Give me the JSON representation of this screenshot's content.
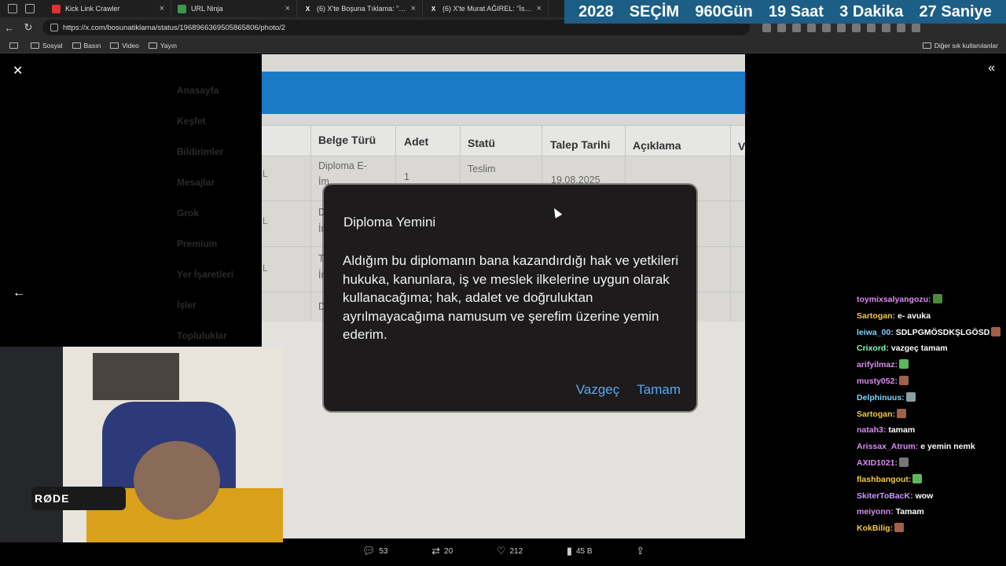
{
  "browser": {
    "tabs": [
      {
        "title": "Kick Link Crawler",
        "favicon": "kick-favicon"
      },
      {
        "title": "URL Ninja",
        "favicon": "ninja-favicon"
      },
      {
        "title": "(6) X'te Boşuna Tıklama: \"İstanbul",
        "favicon": "x-favicon"
      },
      {
        "title": "(6) X'te Murat AĞIREL: \"İstanbul C",
        "favicon": "x-favicon"
      }
    ],
    "url": "https://x.com/bosunatiklama/status/1968966369505865806/photo/2",
    "bookmarks": [
      "Sosyal",
      "Basın",
      "Video",
      "Yayın"
    ],
    "bookmarks_other": "Diğer sık kullanılanlar"
  },
  "countdown": {
    "year": "2028",
    "label": "SEÇİM",
    "days": "960Gün",
    "hours": "19 Saat",
    "minutes": "3  Dakika",
    "seconds": "27 Saniye"
  },
  "photo_table": {
    "headers": [
      "Belge Türü",
      "Adet",
      "Statü",
      "Talep Tarihi",
      "Açıklama",
      "V"
    ],
    "row1": {
      "type": "Diploma E-",
      "type2": "İm",
      "count": "1",
      "status": "Teslim",
      "date": "19.08.2025"
    },
    "row2": {
      "type": "D",
      "type2": "İn"
    },
    "row3": {
      "type": "Tr",
      "type2": "İn"
    },
    "row4": {
      "type": "D"
    },
    "left_marks": [
      "L",
      "L",
      "L"
    ]
  },
  "x_sidebar": [
    "Anasayfa",
    "Keşfet",
    "Bildirimler",
    "Mesajlar",
    "Grok",
    "Premium",
    "Yer İşaretleri",
    "İşler",
    "Topluluklar"
  ],
  "dialog": {
    "title": "Diploma Yemini",
    "body": "Aldığım bu diplomanın bana kazandırdığı hak ve yetkileri hukuka, kanunlara, iş ve meslek ilkelerine uygun olarak kullanacağıma; hak, adalet ve doğruluktan ayrılmayacağıma namusum ve şerefim üzerine yemin ederim.",
    "cancel": "Vazgeç",
    "ok": "Tamam"
  },
  "chat": [
    {
      "user": "toymixsalyangozu:",
      "msg": "",
      "color": "#d98cf0",
      "emote": "#4a8a3a"
    },
    {
      "user": "Sartogan:",
      "msg": "e- avuka",
      "color": "#f5c842",
      "emote": ""
    },
    {
      "user": "leiwa_00:",
      "msg": "SDLPGMÖSDKŞLGÖSD",
      "color": "#7fd3ff",
      "emote": "#a0604a"
    },
    {
      "user": "Crixord:",
      "msg": "vazgeç tamam",
      "color": "#7fffb0",
      "emote": ""
    },
    {
      "user": "arifyilmaz:",
      "msg": "",
      "color": "#d98cf0",
      "emote": "#5cb85c"
    },
    {
      "user": "musty052:",
      "msg": "",
      "color": "#d98cf0",
      "emote": "#a0604a"
    },
    {
      "user": "Delphinuus:",
      "msg": "",
      "color": "#7fd3ff",
      "emote": "#8aa0a0"
    },
    {
      "user": "Sartogan:",
      "msg": "",
      "color": "#f5c842",
      "emote": "#a0604a"
    },
    {
      "user": "natah3:",
      "msg": "tamam",
      "color": "#d98cf0",
      "emote": ""
    },
    {
      "user": "Arissax_Atrum:",
      "msg": "e yemin nemk",
      "color": "#d98cf0",
      "emote": ""
    },
    {
      "user": "AXID1021:",
      "msg": "",
      "color": "#d98cf0",
      "emote": "#777777"
    },
    {
      "user": "flashbangout:",
      "msg": "",
      "color": "#f5c842",
      "emote": "#5cb85c"
    },
    {
      "user": "SkiterToBacK:",
      "msg": "wow",
      "color": "#c99cff",
      "emote": ""
    },
    {
      "user": "meiyonn:",
      "msg": "Tamam",
      "color": "#d98cf0",
      "emote": ""
    },
    {
      "user": "KokBilig:",
      "msg": "",
      "color": "#f5c842",
      "emote": "#a0604a"
    }
  ],
  "webcam": {
    "mic_brand": "RØDE"
  },
  "actions": {
    "replies": "53",
    "reposts": "20",
    "likes": "212",
    "views": "45 B"
  }
}
